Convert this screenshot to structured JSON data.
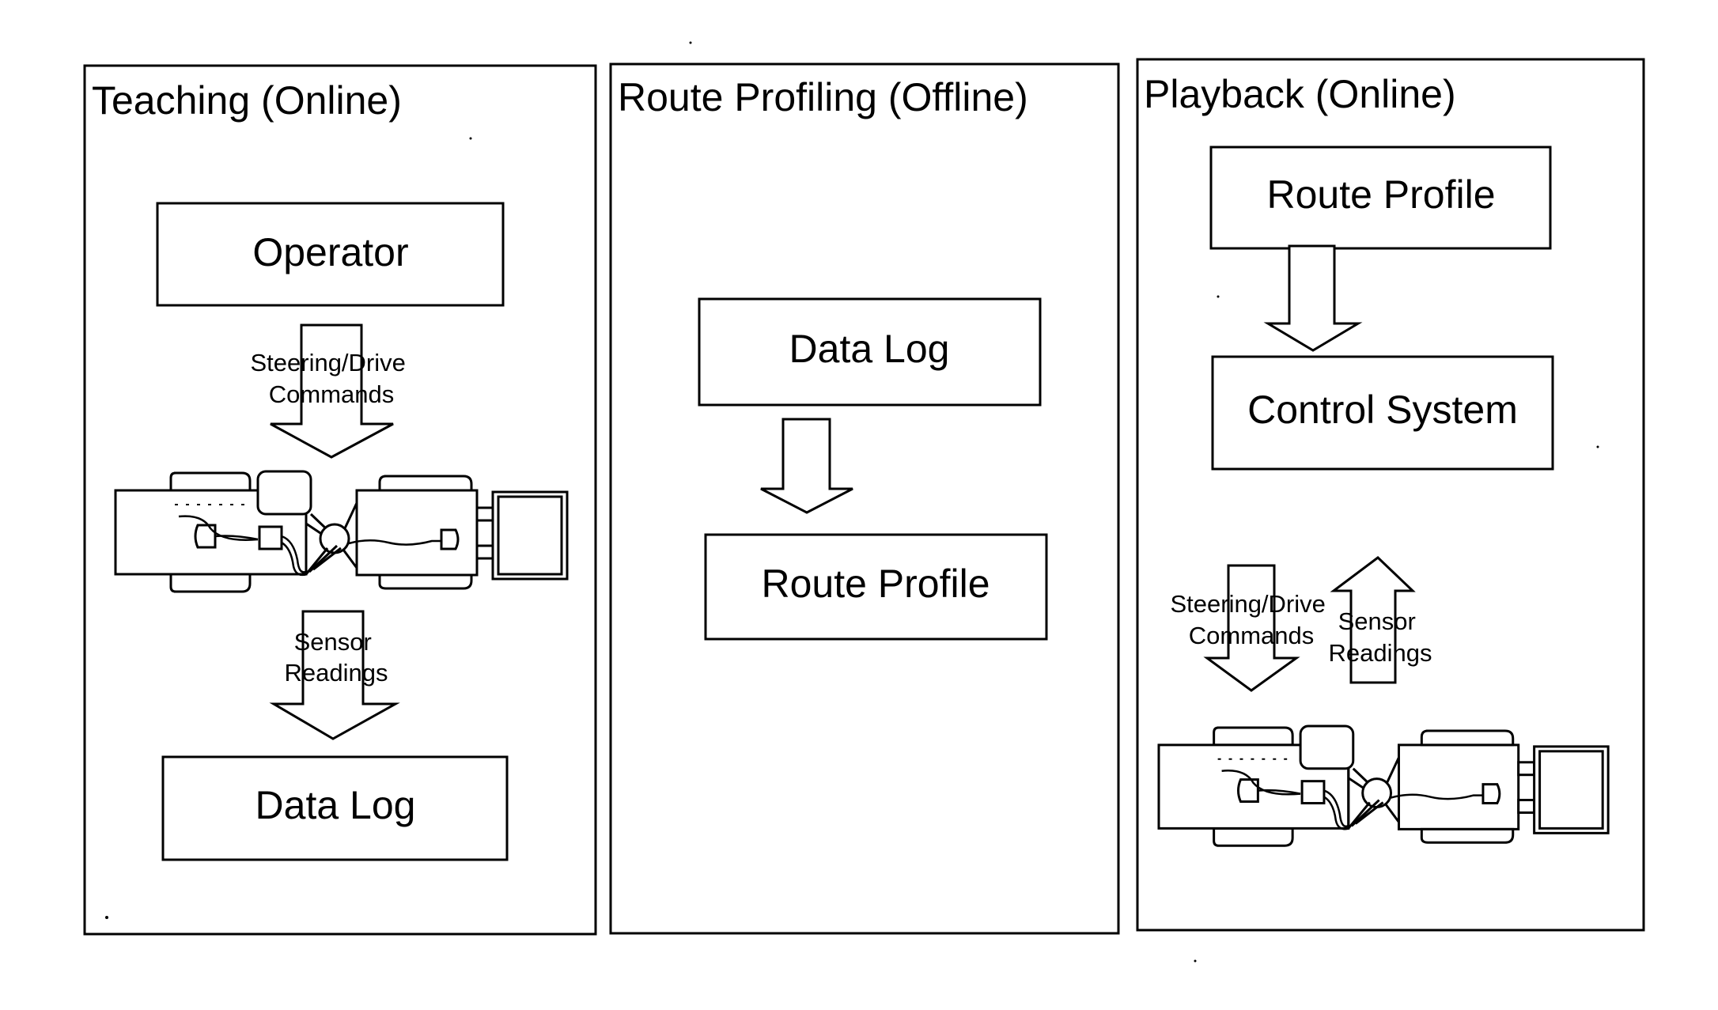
{
  "panels": [
    {
      "title": "Teaching (Online)",
      "boxes": [
        "Operator",
        "Data Log"
      ],
      "arrows": [
        {
          "direction": "down",
          "label_lines": [
            "Steering/Drive",
            "Commands"
          ]
        },
        {
          "direction": "down",
          "label_lines": [
            "Sensor",
            "Readings"
          ]
        }
      ],
      "vehicle": "vehicle-icon"
    },
    {
      "title": "Route Profiling (Offline)",
      "boxes": [
        "Data Log",
        "Route Profile"
      ],
      "arrows": [
        {
          "direction": "down",
          "label_lines": []
        }
      ]
    },
    {
      "title": "Playback (Online)",
      "boxes": [
        "Route Profile",
        "Control System"
      ],
      "arrows": [
        {
          "direction": "down",
          "label_lines": []
        },
        {
          "direction": "down",
          "label_lines": [
            "Steering/Drive",
            "Commands"
          ]
        },
        {
          "direction": "up",
          "label_lines": [
            "Sensor",
            "Readings"
          ]
        }
      ],
      "vehicle": "vehicle-icon"
    }
  ]
}
